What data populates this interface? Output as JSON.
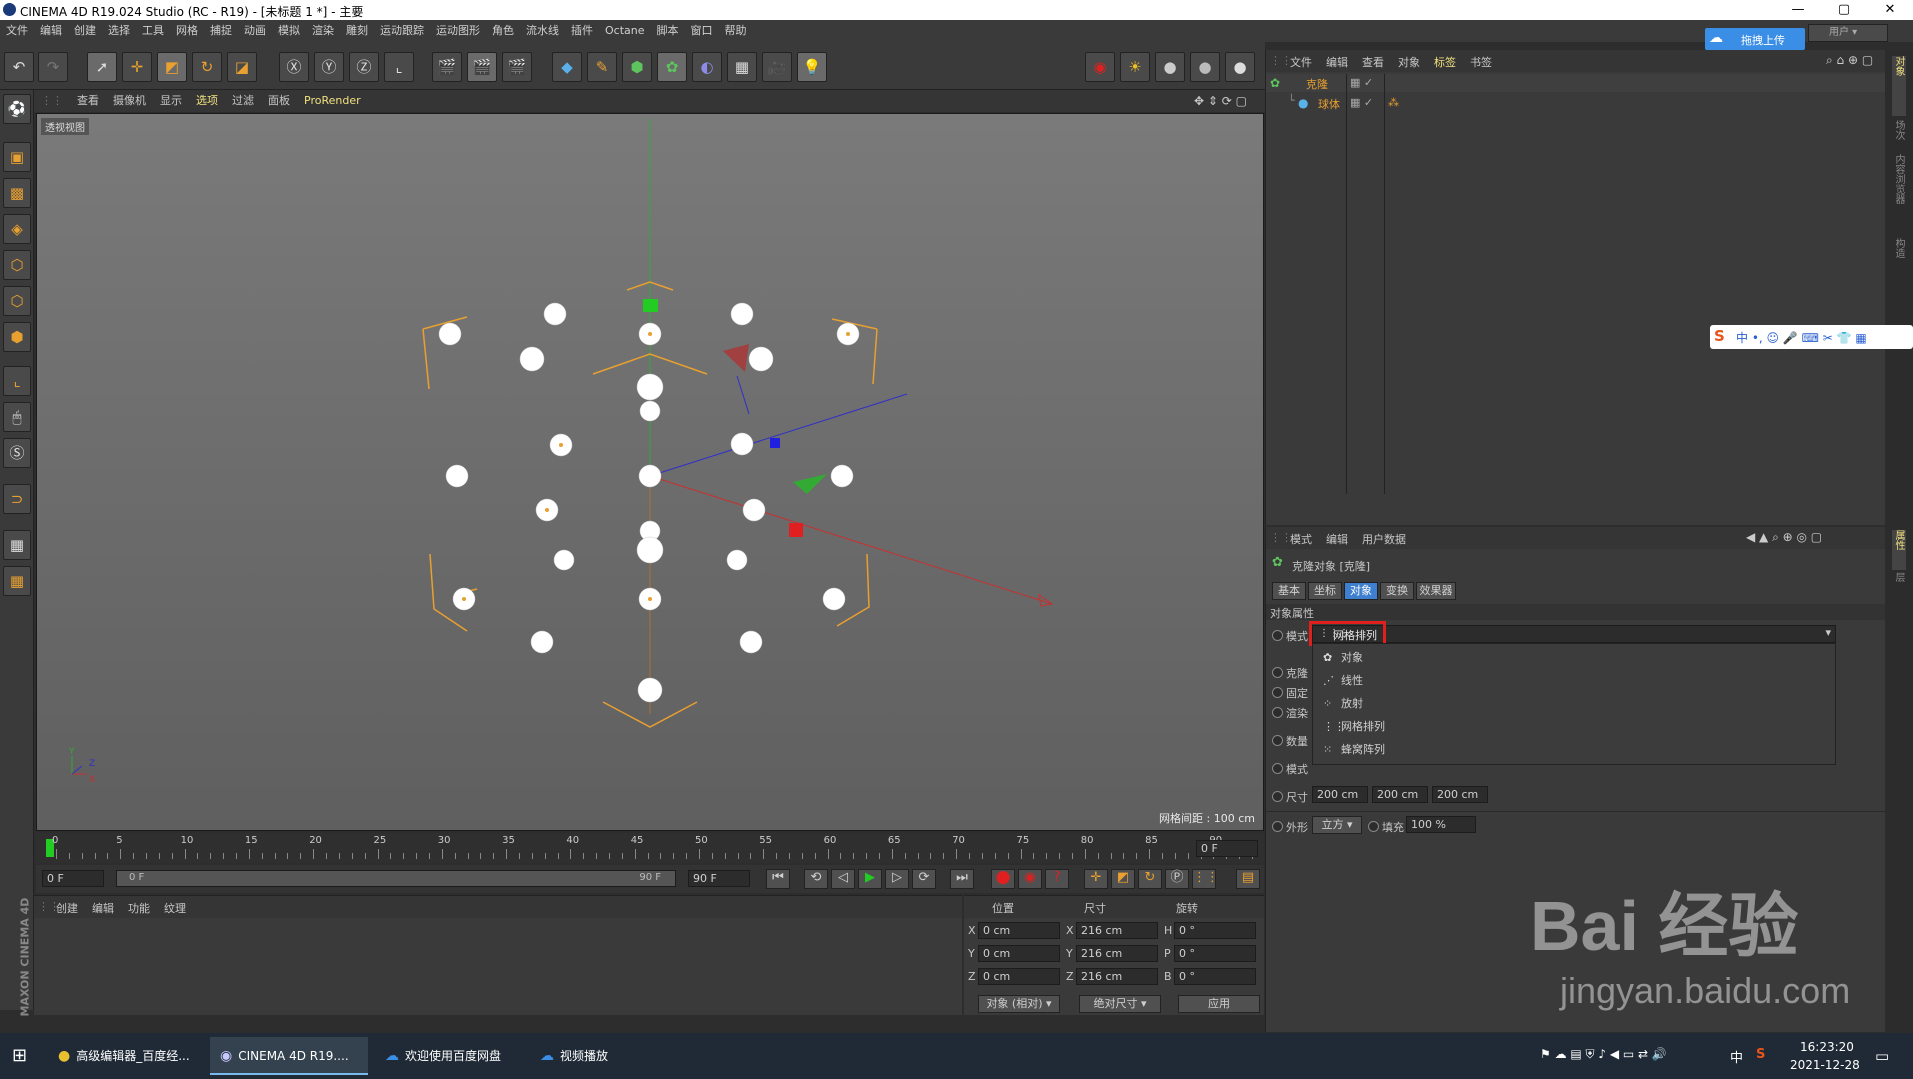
{
  "window": {
    "title": "CINEMA 4D R19.024 Studio (RC - R19) - [未标题 1 *] - 主要",
    "minimize": "—",
    "maximize": "▢",
    "close": "✕"
  },
  "menubar": [
    "文件",
    "编辑",
    "创建",
    "选择",
    "工具",
    "网格",
    "捕捉",
    "动画",
    "模拟",
    "渲染",
    "雕刻",
    "运动跟踪",
    "运动图形",
    "角色",
    "流水线",
    "插件",
    "Octane",
    "脚本",
    "窗口",
    "帮助"
  ],
  "cloud_upload": {
    "label": "拖拽上传",
    "user": "用户"
  },
  "viewport": {
    "menu": [
      "查看",
      "摄像机",
      "显示",
      "选项",
      "过滤",
      "面板",
      "ProRender"
    ],
    "label": "透视视图",
    "grid_distance": "网格间距 : 100 cm"
  },
  "timeline": {
    "ticks": [
      "0",
      "5",
      "10",
      "15",
      "20",
      "25",
      "30",
      "35",
      "40",
      "45",
      "50",
      "55",
      "60",
      "65",
      "70",
      "75",
      "80",
      "85",
      "90"
    ],
    "current_frame": "0 F",
    "start_field": "0 F",
    "range_start": "0 F",
    "range_end": "90 F",
    "end_field": "90 F"
  },
  "material": {
    "menu": [
      "创建",
      "编辑",
      "功能",
      "纹理"
    ],
    "brand": "MAXON CINEMA 4D"
  },
  "coords": {
    "headers": [
      "位置",
      "尺寸",
      "旋转"
    ],
    "rows": [
      {
        "axis": "X",
        "pos": "0 cm",
        "size_axis": "X",
        "size": "216 cm",
        "rot_axis": "H",
        "rot": "0 °"
      },
      {
        "axis": "Y",
        "pos": "0 cm",
        "size_axis": "Y",
        "size": "216 cm",
        "rot_axis": "P",
        "rot": "0 °"
      },
      {
        "axis": "Z",
        "pos": "0 cm",
        "size_axis": "Z",
        "size": "216 cm",
        "rot_axis": "B",
        "rot": "0 °"
      }
    ],
    "mode": "对象 (相对)",
    "size_mode": "绝对尺寸",
    "apply": "应用"
  },
  "object_manager": {
    "menu": [
      "文件",
      "编辑",
      "查看",
      "对象",
      "标签",
      "书签"
    ],
    "objects": [
      {
        "name": "克隆",
        "level": 0
      },
      {
        "name": "球体",
        "level": 1
      }
    ]
  },
  "attributes": {
    "menu": [
      "模式",
      "编辑",
      "用户数据"
    ],
    "object_title": "克隆对象 [克隆]",
    "tabs": [
      "基本",
      "坐标",
      "对象",
      "变换",
      "效果器"
    ],
    "active_tab": "对象",
    "section": "对象属性",
    "mode_label": "模式",
    "mode_value": "网格排列",
    "dropdown_options": [
      "对象",
      "线性",
      "放射",
      "网格排列",
      "蜂窝阵列"
    ],
    "hidden_labels": [
      "克隆",
      "固定",
      "渲染",
      "数量",
      "模式"
    ],
    "size_label": "尺寸",
    "size_values": [
      "200 cm",
      "200 cm",
      "200 cm"
    ],
    "shape_label": "外形",
    "shape_value": "立方",
    "fill_label": "填充",
    "fill_value": "100 %"
  },
  "right_tabs": [
    "对象",
    "场次",
    "内容浏览器",
    "构造",
    "属性",
    "层"
  ],
  "taskbar": {
    "items": [
      {
        "label": "高级编辑器_百度经...",
        "active": false
      },
      {
        "label": "CINEMA 4D R19....",
        "active": true
      },
      {
        "label": "欢迎使用百度网盘",
        "active": false
      },
      {
        "label": "视频播放",
        "active": false
      }
    ],
    "ime": "中",
    "time": "16:23:20",
    "date": "2021-12-28"
  },
  "watermark": {
    "text": "Bai 经验",
    "url": "jingyan.baidu.com"
  },
  "colors": {
    "highlight_box": "#e0201c",
    "accent_blue": "#3f7fcf",
    "cloner_orange": "#e8a030",
    "green_axis": "#22cc22"
  }
}
